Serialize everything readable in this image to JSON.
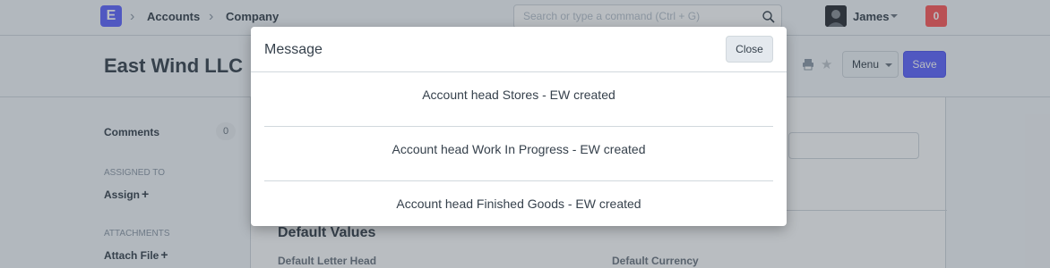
{
  "navbar": {
    "logo_letter": "E",
    "breadcrumbs": [
      "Accounts",
      "Company"
    ],
    "search_placeholder": "Search or type a command (Ctrl + G)",
    "user_name": "James",
    "notification_count": "0"
  },
  "page_head": {
    "title": "East Wind LLC",
    "menu_label": "Menu",
    "save_label": "Save"
  },
  "sidebar": {
    "comments_label": "Comments",
    "comments_count": "0",
    "assigned_to_heading": "ASSIGNED TO",
    "assign_label": "Assign",
    "attachments_heading": "ATTACHMENTS",
    "attach_label": "Attach File"
  },
  "form": {
    "section_title": "Default Values",
    "field_default_letter_head": "Default Letter Head",
    "field_default_currency": "Default Currency"
  },
  "modal": {
    "title": "Message",
    "close_label": "Close",
    "messages": [
      "Account head Stores - EW created",
      "Account head Work In Progress - EW created",
      "Account head Finished Goods - EW created"
    ]
  },
  "colors": {
    "primary": "#5e64ff",
    "danger": "#ff5858",
    "text": "#36414c"
  }
}
